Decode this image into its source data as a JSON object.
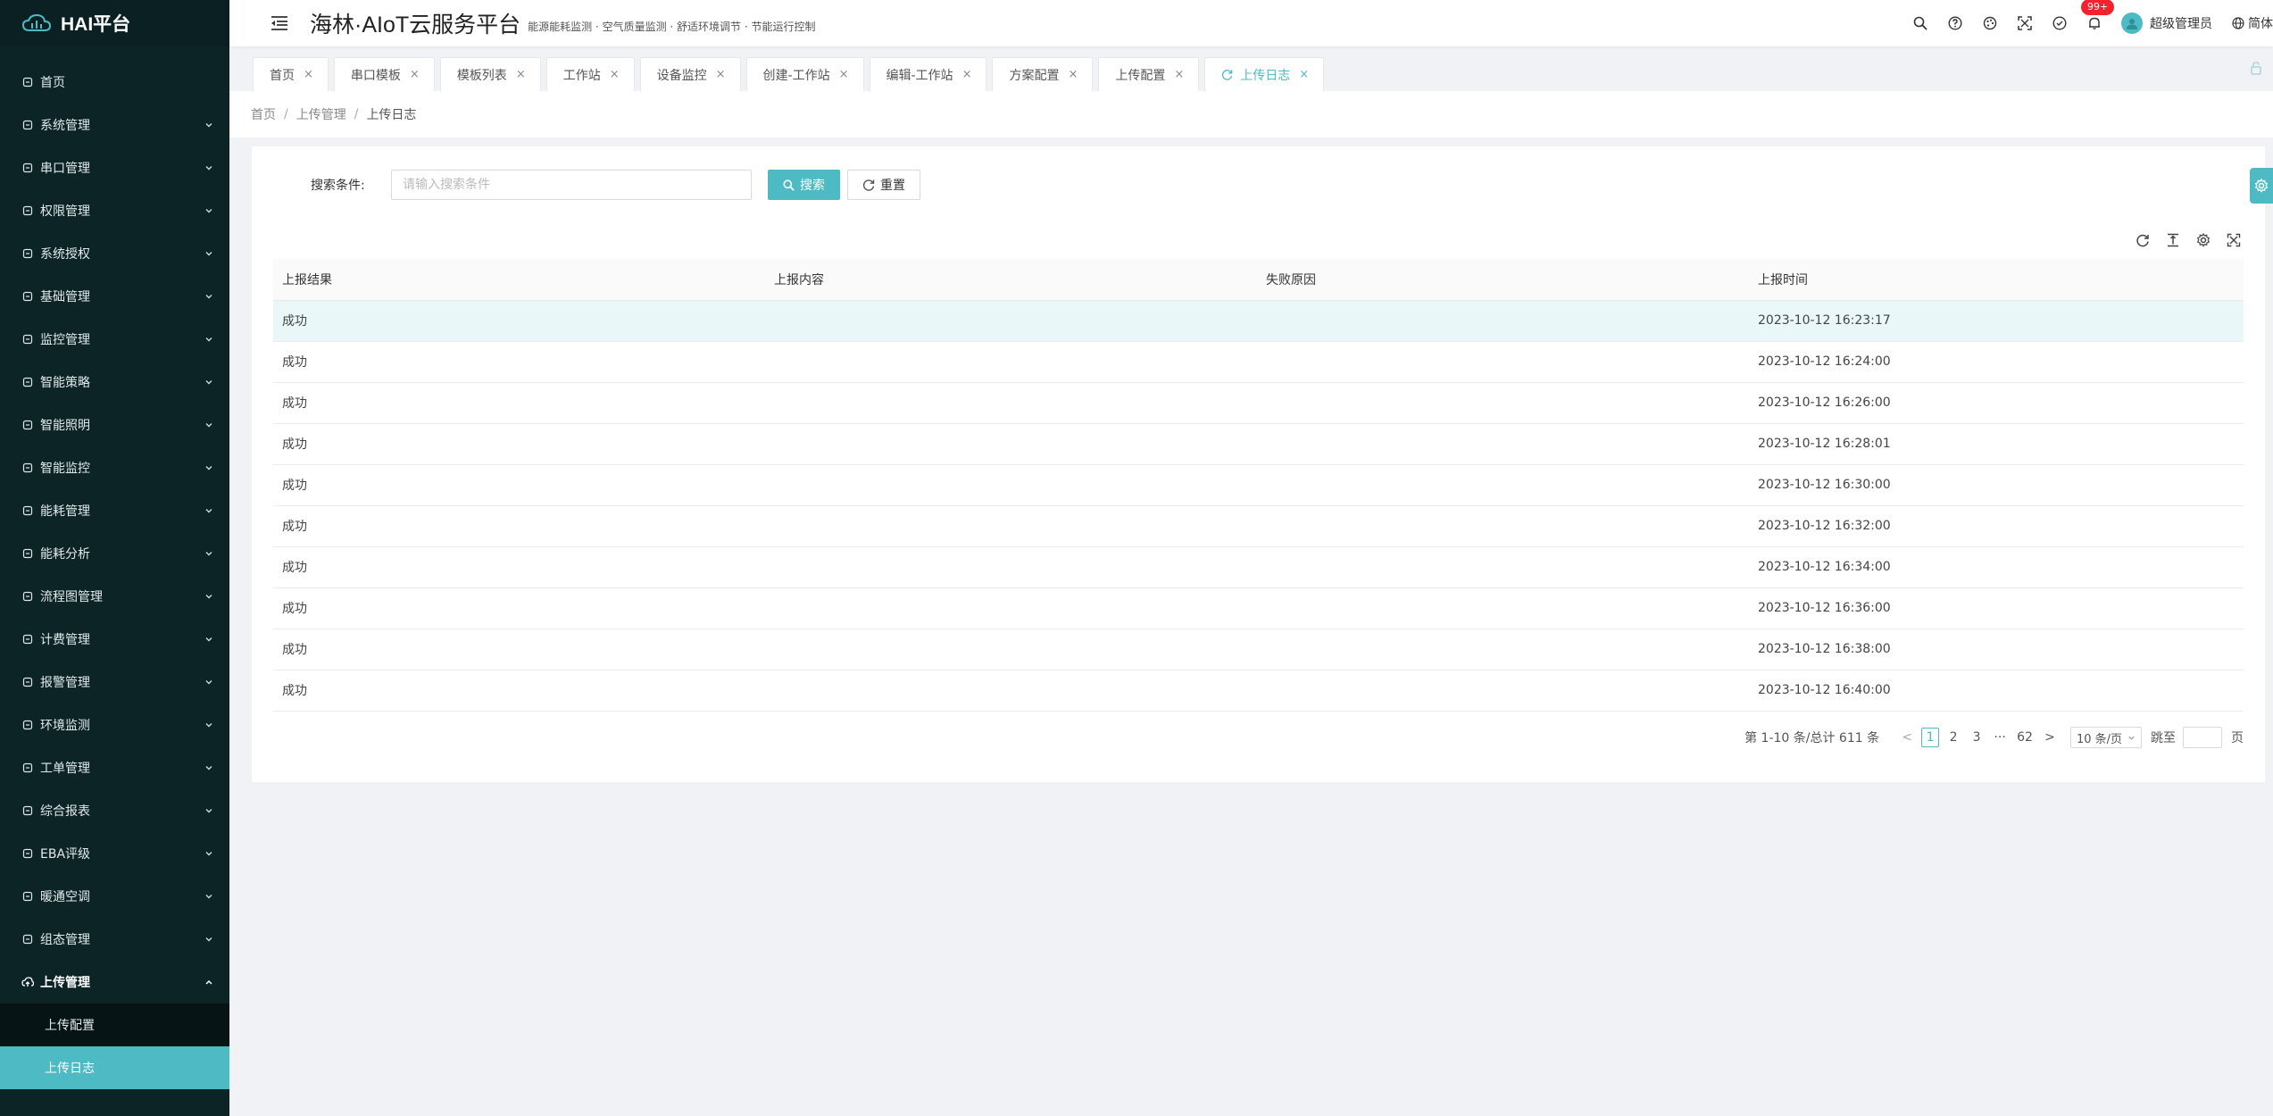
{
  "brand": {
    "name": "HAI平台"
  },
  "header": {
    "title": "海林·AIoT云服务平台",
    "subtitle": "能源能耗监测 · 空气质量监测 · 舒适环境调节 · 节能运行控制",
    "notify_badge": "99+",
    "user_name": "超级管理员",
    "lang": "简体"
  },
  "sidebar": {
    "items": [
      {
        "label": "首页",
        "icon": "dashboard-icon",
        "has_children": false
      },
      {
        "label": "系统管理",
        "icon": "monitor-icon",
        "has_children": true
      },
      {
        "label": "串口管理",
        "icon": "sliders-icon",
        "has_children": true
      },
      {
        "label": "权限管理",
        "icon": "shield-icon",
        "has_children": true
      },
      {
        "label": "系统授权",
        "icon": "certificate-icon",
        "has_children": true
      },
      {
        "label": "基础管理",
        "icon": "database-icon",
        "has_children": true
      },
      {
        "label": "监控管理",
        "icon": "camera-icon",
        "has_children": true
      },
      {
        "label": "智能策略",
        "icon": "bulb-icon",
        "has_children": true
      },
      {
        "label": "智能照明",
        "icon": "light-icon",
        "has_children": true
      },
      {
        "label": "智能监控",
        "icon": "screen-icon",
        "has_children": true
      },
      {
        "label": "能耗管理",
        "icon": "sliders-icon",
        "has_children": true
      },
      {
        "label": "能耗分析",
        "icon": "bar-chart-icon",
        "has_children": true
      },
      {
        "label": "流程图管理",
        "icon": "flow-icon",
        "has_children": true
      },
      {
        "label": "计费管理",
        "icon": "wallet-icon",
        "has_children": true
      },
      {
        "label": "报警管理",
        "icon": "alarm-icon",
        "has_children": true
      },
      {
        "label": "环境监测",
        "icon": "leaf-icon",
        "has_children": true
      },
      {
        "label": "工单管理",
        "icon": "layers-icon",
        "has_children": true
      },
      {
        "label": "综合报表",
        "icon": "report-icon",
        "has_children": true
      },
      {
        "label": "EBA评级",
        "icon": "badge-icon",
        "has_children": true
      },
      {
        "label": "暖通空调",
        "icon": "wind-icon",
        "has_children": true
      },
      {
        "label": "组态管理",
        "icon": "gear-icon",
        "has_children": true
      }
    ],
    "open_group": {
      "label": "上传管理",
      "icon": "cloud-upload-icon",
      "children": [
        {
          "label": "上传配置",
          "active": false
        },
        {
          "label": "上传日志",
          "active": true
        }
      ]
    }
  },
  "tabs": [
    {
      "label": "首页",
      "active": false
    },
    {
      "label": "串口模板",
      "active": false
    },
    {
      "label": "模板列表",
      "active": false
    },
    {
      "label": "工作站",
      "active": false
    },
    {
      "label": "设备监控",
      "active": false
    },
    {
      "label": "创建-工作站",
      "active": false
    },
    {
      "label": "编辑-工作站",
      "active": false
    },
    {
      "label": "方案配置",
      "active": false
    },
    {
      "label": "上传配置",
      "active": false
    },
    {
      "label": "上传日志",
      "active": true
    }
  ],
  "breadcrumb": [
    "首页",
    "上传管理",
    "上传日志"
  ],
  "search": {
    "label": "搜索条件:",
    "placeholder": "请输入搜索条件",
    "value": "",
    "search_btn": "搜索",
    "reset_btn": "重置"
  },
  "table": {
    "columns": [
      "上报结果",
      "上报内容",
      "失败原因",
      "上报时间"
    ],
    "rows": [
      [
        "成功",
        "",
        "",
        "2023-10-12 16:23:17"
      ],
      [
        "成功",
        "",
        "",
        "2023-10-12 16:24:00"
      ],
      [
        "成功",
        "",
        "",
        "2023-10-12 16:26:00"
      ],
      [
        "成功",
        "",
        "",
        "2023-10-12 16:28:01"
      ],
      [
        "成功",
        "",
        "",
        "2023-10-12 16:30:00"
      ],
      [
        "成功",
        "",
        "",
        "2023-10-12 16:32:00"
      ],
      [
        "成功",
        "",
        "",
        "2023-10-12 16:34:00"
      ],
      [
        "成功",
        "",
        "",
        "2023-10-12 16:36:00"
      ],
      [
        "成功",
        "",
        "",
        "2023-10-12 16:38:00"
      ],
      [
        "成功",
        "",
        "",
        "2023-10-12 16:40:00"
      ]
    ]
  },
  "pagination": {
    "total_text": "第 1-10 条/总计 611 条",
    "prev": "<",
    "pages": [
      "1",
      "2",
      "3"
    ],
    "ellipsis": "···",
    "last": "62",
    "next": ">",
    "page_size": "10 条/页",
    "jump_label": "跳至",
    "jump_suffix": "页",
    "current": "1"
  },
  "colors": {
    "accent": "#4dbac4",
    "sidebar_bg": "#0d2427",
    "badge": "#f5222d"
  }
}
